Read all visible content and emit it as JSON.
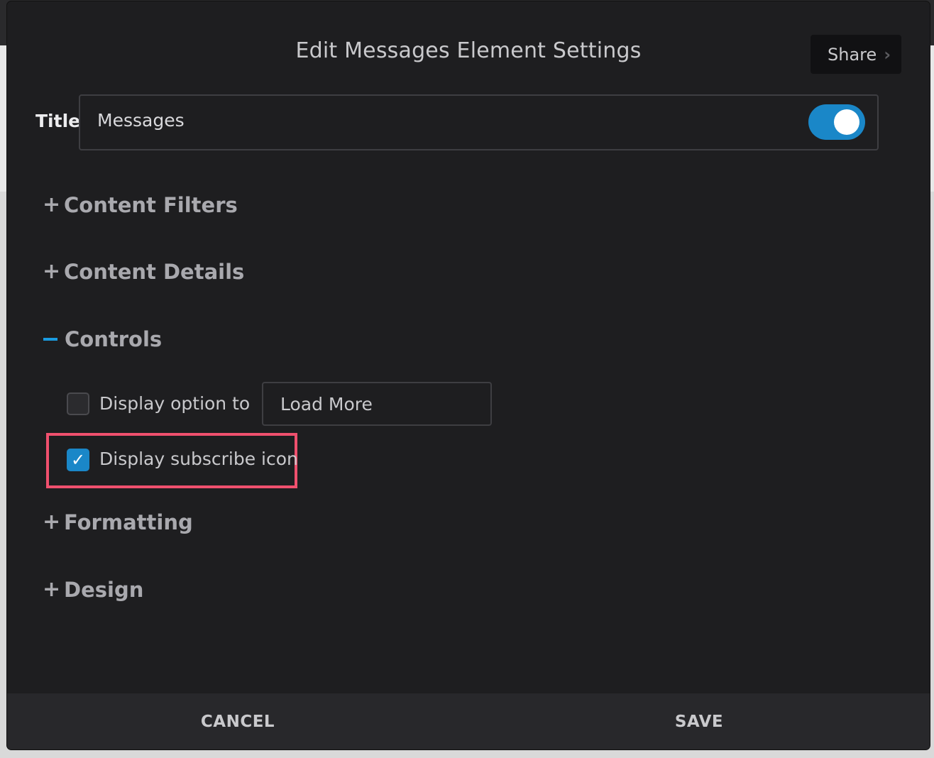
{
  "dialog": {
    "title": "Edit Messages Element Settings",
    "share_label": "Share",
    "share_icon": "chevron-right-icon"
  },
  "title_field": {
    "label": "Title",
    "value": "Messages",
    "toggle_on": true,
    "toggle_color": "#1a87c8"
  },
  "sections": [
    {
      "label": "Content Filters",
      "expanded": false
    },
    {
      "label": "Content Details",
      "expanded": false
    },
    {
      "label": "Controls",
      "expanded": true
    },
    {
      "label": "Formatting",
      "expanded": false
    },
    {
      "label": "Design",
      "expanded": false
    }
  ],
  "controls": {
    "display_option": {
      "label": "Display option to",
      "checked": false,
      "value": "Load More"
    },
    "display_subscribe": {
      "label": "Display subscribe icon",
      "checked": true,
      "check_glyph": "✓"
    }
  },
  "footer": {
    "cancel_label": "CANCEL",
    "save_label": "SAVE"
  },
  "colors": {
    "accent": "#1a87c8",
    "highlight": "#f0506e",
    "background": "#1e1e20"
  }
}
